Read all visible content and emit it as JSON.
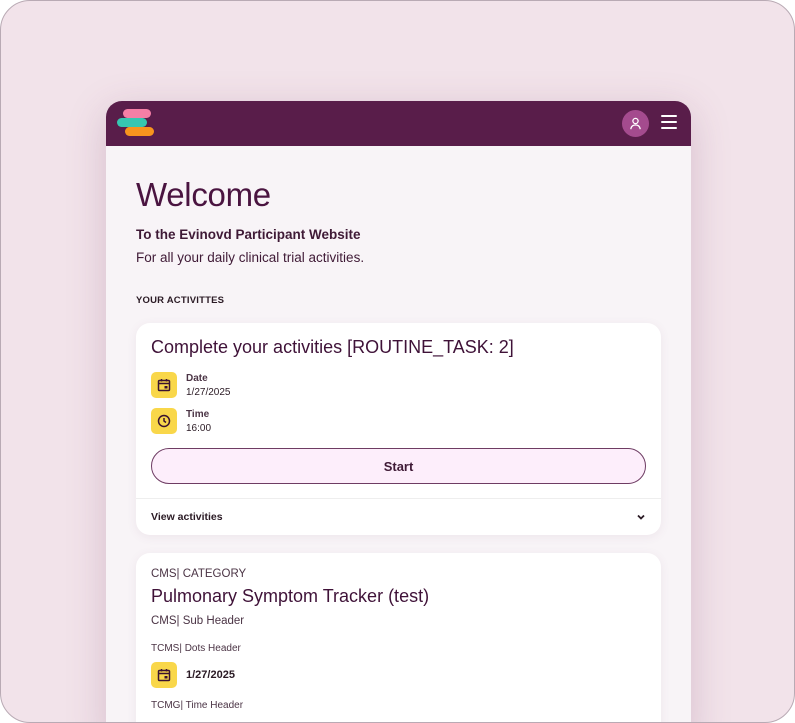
{
  "header": {
    "logo": "evinovd-logo",
    "profile_icon": "user-icon",
    "menu_icon": "hamburger-icon"
  },
  "welcome": {
    "title": "Welcome",
    "subtitle": "To the Evinovd Participant Website",
    "tagline": "For all your daily clinical trial activities."
  },
  "activities": {
    "section_label": "YOUR ACTIVITTES",
    "card": {
      "title": "Complete your activities [ROUTINE_TASK: 2]",
      "date_label": "Date",
      "date_value": "1/27/2025",
      "time_label": "Time",
      "time_value": "16:00",
      "start_label": "Start",
      "view_label": "View activities"
    }
  },
  "tracker": {
    "category": "CMS| CATEGORY",
    "title": "Pulmonary Symptom Tracker (test)",
    "sub_header": "CMS| Sub Header",
    "dots_header": "TCMS| Dots Header",
    "date_value": "1/27/2025",
    "time_header": "TCMG| Time Header"
  },
  "colors": {
    "topbar": "#591d4a",
    "accent_yellow": "#f9d74a",
    "background": "#f2e3ea"
  }
}
